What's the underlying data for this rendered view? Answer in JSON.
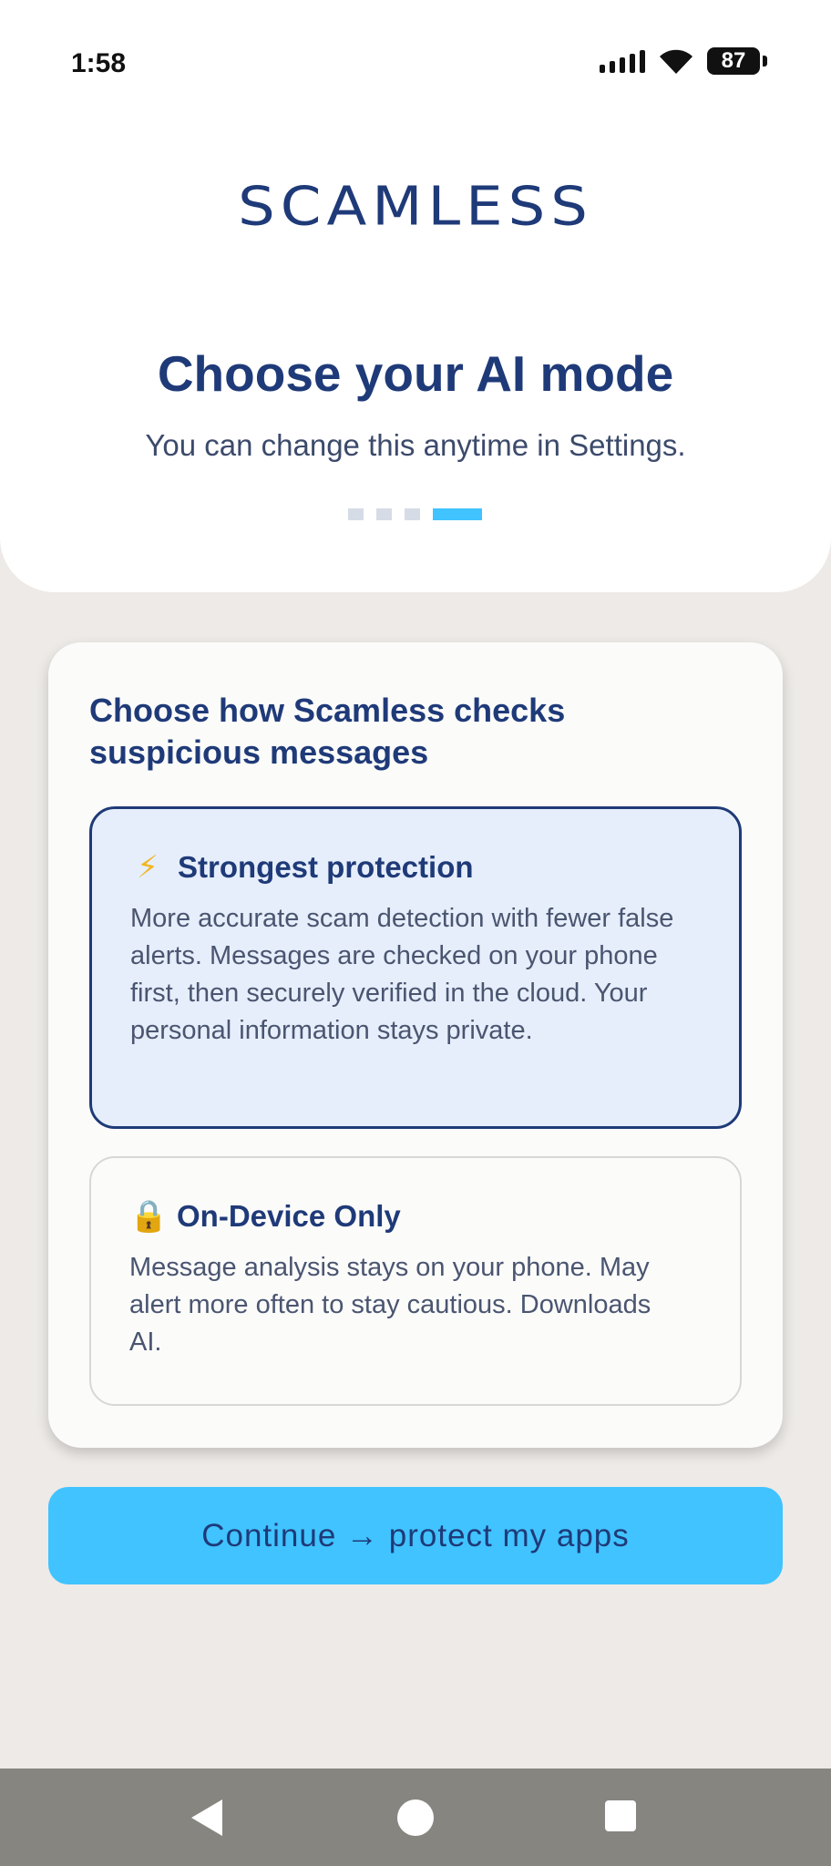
{
  "status_bar": {
    "time": "1:58",
    "battery": "87",
    "icons": [
      "signal-icon",
      "wifi-icon",
      "battery-icon"
    ]
  },
  "header": {
    "logo_text": "SCAMLESS",
    "title": "Choose your AI mode",
    "subtitle": "You can change this anytime in Settings.",
    "steps": {
      "total": 4,
      "current": 4
    }
  },
  "card": {
    "heading": "Choose how Scamless checks suspicious messages",
    "options": [
      {
        "icon": "lightning-bolt-icon",
        "icon_glyph": "⚡",
        "title": "Strongest protection",
        "description": "More accurate scam detection with fewer false alerts. Messages are checked on your phone first, then securely verified in the cloud. Your personal information stays private.",
        "selected": true
      },
      {
        "icon": "lock-icon",
        "icon_glyph": "🔒",
        "title": "On-Device Only",
        "description": "Message analysis stays on your phone. May alert more often to stay cautious. Downloads AI.",
        "selected": false
      }
    ]
  },
  "continue_button": {
    "label": "Continue → protect my apps"
  },
  "nav_bar": {
    "icons": [
      "back-icon",
      "home-icon",
      "recents-icon"
    ]
  },
  "colors": {
    "brand_navy": "#1f3a78",
    "accent_blue": "#40c3ff",
    "selected_bg": "#e6eefb",
    "page_bg": "#edeae7",
    "nav_bg": "#878580"
  }
}
